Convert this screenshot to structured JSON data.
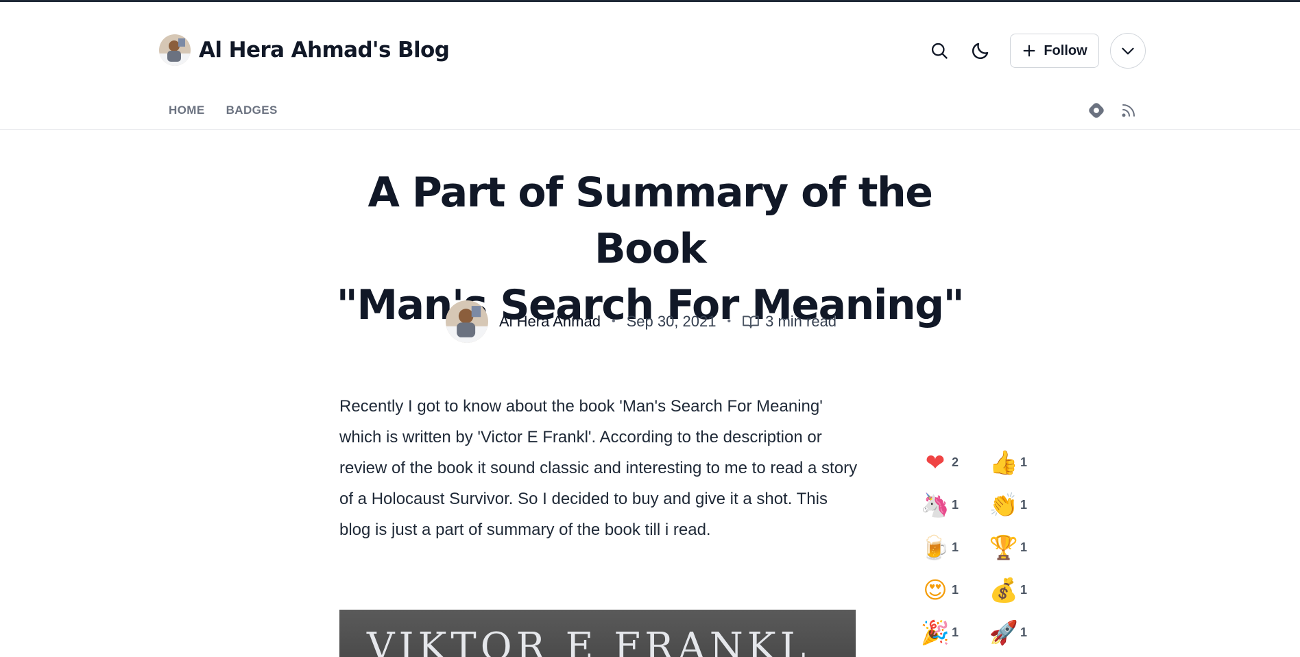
{
  "header": {
    "blog_title": "Al Hera Ahmad's Blog",
    "follow_label": "Follow"
  },
  "nav": {
    "items": [
      "HOME",
      "BADGES"
    ]
  },
  "article": {
    "title_line1": "A Part of Summary of the Book",
    "title_line2": "\"Man's Search For Meaning\"",
    "author": "Al Hera Ahmad",
    "date": "Sep 30, 2021",
    "read_time": "3 min read",
    "paragraph": "Recently I got to know about the book 'Man's Search For Meaning' which is written by 'Victor E Frankl'. According to the description or review of the book it sound classic and interesting to me to read a story of a Holocaust Survivor. So I decided to buy and give it a shot. This blog is just a part of summary of the book till i read.",
    "cover_text": "VIKTOR E FRANKL"
  },
  "reactions": [
    {
      "icon": "heart-icon",
      "glyph": "❤",
      "color": "#ef4444",
      "count": "2"
    },
    {
      "icon": "thumbs-up-icon",
      "glyph": "👍",
      "color": "#f59e0b",
      "count": "1"
    },
    {
      "icon": "unicorn-icon",
      "glyph": "🦄",
      "color": "#ec4899",
      "count": "1"
    },
    {
      "icon": "clap-icon",
      "glyph": "👏",
      "color": "#f59e0b",
      "count": "1"
    },
    {
      "icon": "beer-icon",
      "glyph": "🍺",
      "color": "#f59e0b",
      "count": "1"
    },
    {
      "icon": "trophy-icon",
      "glyph": "🏆",
      "color": "#eab308",
      "count": "1"
    },
    {
      "icon": "heart-eyes-icon",
      "glyph": "😍",
      "color": "#f59e0b",
      "count": "1"
    },
    {
      "icon": "money-bag-icon",
      "glyph": "💰",
      "color": "#d97706",
      "count": "1"
    },
    {
      "icon": "party-popper-icon",
      "glyph": "🎉",
      "color": "#8b5cf6",
      "count": "1"
    },
    {
      "icon": "rocket-icon",
      "glyph": "🚀",
      "color": "#94a3b8",
      "count": "1"
    }
  ]
}
